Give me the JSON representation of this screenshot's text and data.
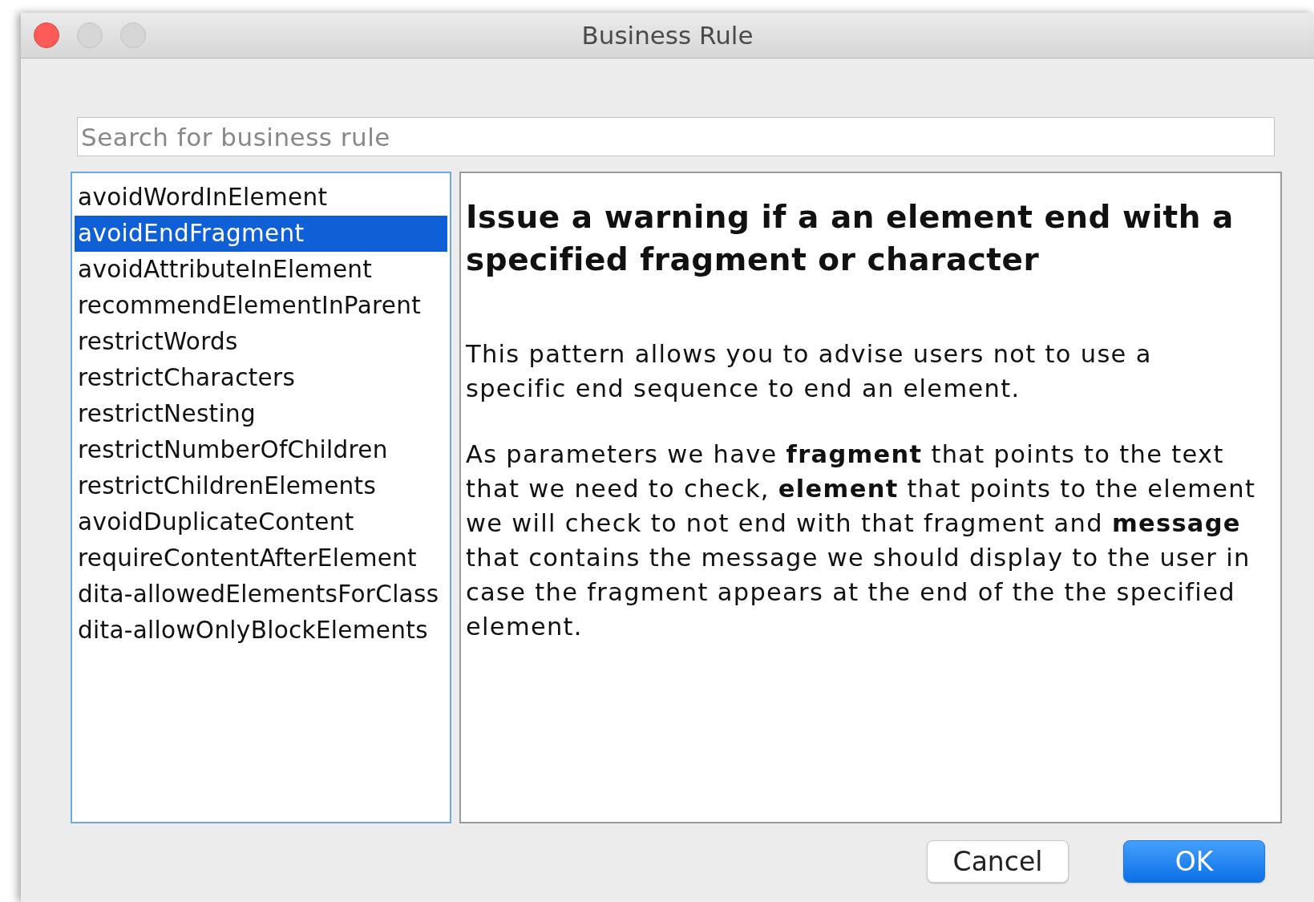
{
  "window": {
    "title": "Business Rule"
  },
  "search": {
    "placeholder": "Search for business rule"
  },
  "rules": [
    {
      "label": "avoidWordInElement",
      "selected": false
    },
    {
      "label": "avoidEndFragment",
      "selected": true
    },
    {
      "label": "avoidAttributeInElement",
      "selected": false
    },
    {
      "label": "recommendElementInParent",
      "selected": false
    },
    {
      "label": "restrictWords",
      "selected": false
    },
    {
      "label": "restrictCharacters",
      "selected": false
    },
    {
      "label": "restrictNesting",
      "selected": false
    },
    {
      "label": "restrictNumberOfChildren",
      "selected": false
    },
    {
      "label": "restrictChildrenElements",
      "selected": false
    },
    {
      "label": "avoidDuplicateContent",
      "selected": false
    },
    {
      "label": "requireContentAfterElement",
      "selected": false
    },
    {
      "label": "dita-allowedElementsForClass",
      "selected": false
    },
    {
      "label": "dita-allowOnlyBlockElements",
      "selected": false
    }
  ],
  "description": {
    "heading": "Issue a warning if a an element end with a specified fragment or character",
    "paragraphs": [
      "This pattern allows you to advise users not to use a specific end sequence to end an element.",
      "As parameters we have **fragment** that points to the text that we need to check, **element** that points to the element we will check to not end with that fragment and **message** that contains the message we should display to the user in case the fragment appears at the end of the the specified element."
    ]
  },
  "buttons": [
    {
      "label": "Cancel",
      "default": false
    },
    {
      "label": "OK",
      "default": true
    }
  ]
}
